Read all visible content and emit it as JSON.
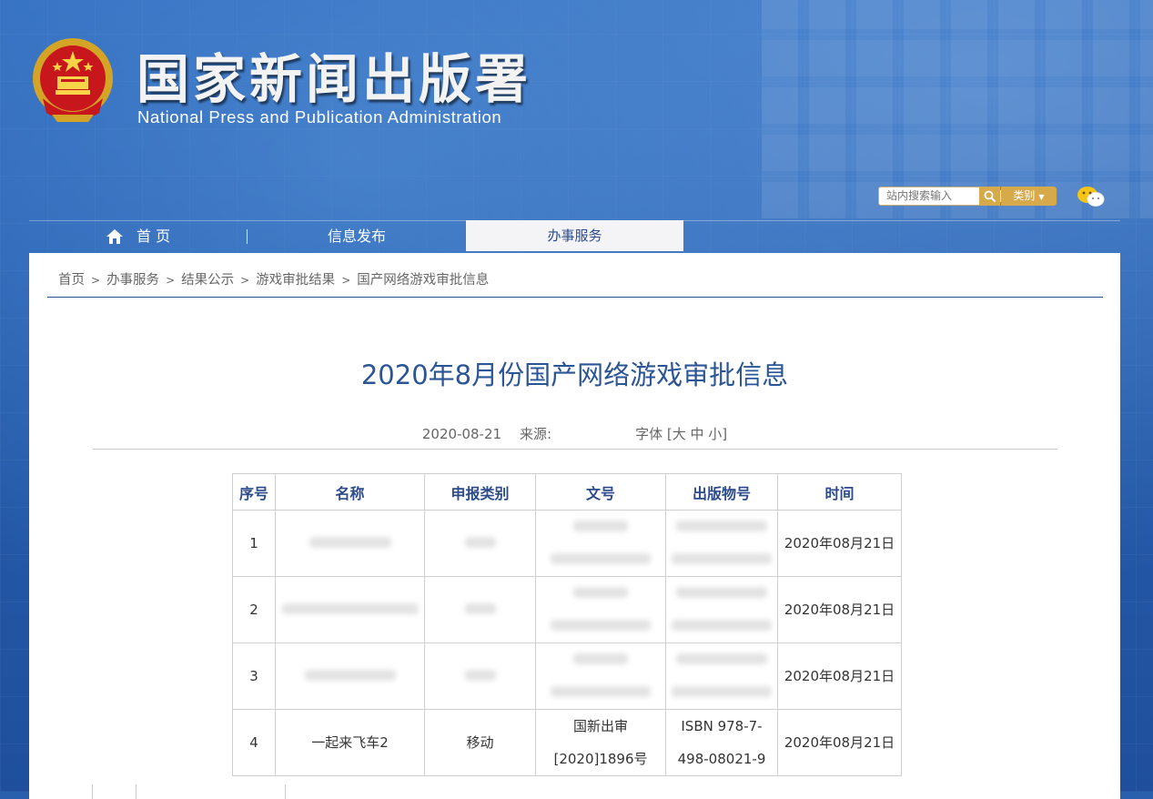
{
  "site": {
    "name_cn": "国家新闻出版署",
    "name_en": "National  Press and Publication Administration",
    "emblem_icon": "national-emblem-icon"
  },
  "search": {
    "placeholder": "站内搜索输入",
    "category_label": "类别",
    "search_icon": "search-icon",
    "wechat_icon": "wechat-icon"
  },
  "nav": {
    "home": "首 页",
    "info": "信息发布",
    "service": "办事服务"
  },
  "breadcrumb": {
    "items": [
      "首页",
      "办事服务",
      "结果公示",
      "游戏审批结果",
      "国产网络游戏审批信息"
    ],
    "separator": ">"
  },
  "article": {
    "title": "2020年8月份国产网络游戏审批信息",
    "date": "2020-08-21",
    "source_label": "来源:",
    "font_label": "字体 [大 中 小]"
  },
  "table": {
    "headers": [
      "序号",
      "名称",
      "申报类别",
      "文号",
      "出版物号",
      "时间"
    ],
    "rows": [
      {
        "no": "1",
        "name": "",
        "type": "",
        "doc_line1": "",
        "doc_line2": "",
        "isbn_line1": "",
        "isbn_line2": "",
        "date": "2020年08月21日"
      },
      {
        "no": "2",
        "name": "",
        "type": "",
        "doc_line1": "",
        "doc_line2": "",
        "isbn_line1": "",
        "isbn_line2": "",
        "date": "2020年08月21日"
      },
      {
        "no": "3",
        "name": "",
        "type": "",
        "doc_line1": "",
        "doc_line2": "",
        "isbn_line1": "",
        "isbn_line2": "",
        "date": "2020年08月21日"
      },
      {
        "no": "4",
        "name": "一起来飞车2",
        "type": "移动",
        "doc_line1": "国新出审",
        "doc_line2": "[2020]1896号",
        "isbn_line1": "ISBN 978-7-",
        "isbn_line2": "498-08021-9",
        "date": "2020年08月21日"
      }
    ]
  },
  "colors": {
    "banner_blue": "#2a5fae",
    "title_blue": "#2b5595",
    "accent_gold": "#d6a94a",
    "emblem_red": "#c8161d"
  }
}
